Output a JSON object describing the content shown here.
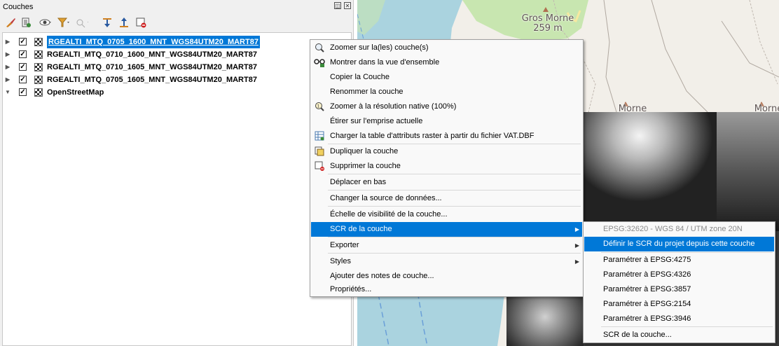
{
  "panel": {
    "title": "Couches",
    "float_btn": "◫",
    "close_btn": "✕"
  },
  "toolbar": {
    "buttons": [
      "style-manager",
      "add-group",
      "visibility",
      "filter",
      "filter-legend",
      "expand-all",
      "collapse-all",
      "remove-layer"
    ]
  },
  "layers": [
    {
      "name": "RGEALTI_MTQ_0705_1600_MNT_WGS84UTM20_MART87",
      "checked": "✓",
      "selected": true
    },
    {
      "name": "RGEALTI_MTQ_0710_1600_MNT_WGS84UTM20_MART87",
      "checked": "✓",
      "selected": false
    },
    {
      "name": "RGEALTI_MTQ_0710_1605_MNT_WGS84UTM20_MART87",
      "checked": "✓",
      "selected": false
    },
    {
      "name": "RGEALTI_MTQ_0705_1605_MNT_WGS84UTM20_MART87",
      "checked": "✓",
      "selected": false
    },
    {
      "name": "OpenStreetMap",
      "checked": "✓",
      "selected": false
    }
  ],
  "context_menu": {
    "items": [
      {
        "label": "Zoomer sur la(les) couche(s)",
        "icon": "zoom-icon"
      },
      {
        "label": "Montrer dans la vue d'ensemble",
        "icon": "overview-icon"
      },
      {
        "label": "Copier la Couche",
        "icon": ""
      },
      {
        "label": "Renommer la couche",
        "icon": ""
      },
      {
        "label": "Zoomer à la résolution native (100%)",
        "icon": "zoom-native-icon"
      },
      {
        "label": "Étirer sur l'emprise actuelle",
        "icon": ""
      },
      {
        "label": "Charger la table d'attributs raster à partir du fichier VAT.DBF",
        "icon": "attribute-table-icon"
      },
      {
        "label": "Dupliquer la couche",
        "icon": "duplicate-icon"
      },
      {
        "label": "Supprimer la couche",
        "icon": "remove-icon"
      },
      {
        "label": "Déplacer en bas",
        "icon": ""
      },
      {
        "label": "Changer la source de données...",
        "icon": ""
      },
      {
        "label": "Échelle de visibilité de la couche...",
        "icon": ""
      },
      {
        "label": "SCR de la couche",
        "icon": "",
        "submenu": true,
        "active": true
      },
      {
        "label": "Exporter",
        "icon": "",
        "submenu": true
      },
      {
        "label": "Styles",
        "icon": "",
        "submenu": true
      },
      {
        "label": "Ajouter des notes de couche...",
        "icon": ""
      },
      {
        "label": "Propriétés...",
        "icon": ""
      }
    ],
    "arrow": "▶"
  },
  "crs_submenu": {
    "items": [
      {
        "label": "EPSG:32620 - WGS 84 / UTM zone 20N",
        "disabled": true
      },
      {
        "label": "Définir le SCR du projet depuis cette couche",
        "active": true
      },
      {
        "label": "Paramétrer à EPSG:4275"
      },
      {
        "label": "Paramétrer à EPSG:4326"
      },
      {
        "label": "Paramétrer à EPSG:3857"
      },
      {
        "label": "Paramétrer à EPSG:2154"
      },
      {
        "label": "Paramétrer à EPSG:3946"
      },
      {
        "label": "SCR de la couche..."
      }
    ]
  },
  "map": {
    "labels": [
      {
        "name": "Gros Morne",
        "elevation": "259 m"
      },
      {
        "name": "Morne"
      },
      {
        "name": "Morne"
      }
    ]
  },
  "colors": {
    "selection": "#0078d7",
    "sea": "#aad3df",
    "land": "#f2efe9",
    "green": "#c8e6b0"
  }
}
